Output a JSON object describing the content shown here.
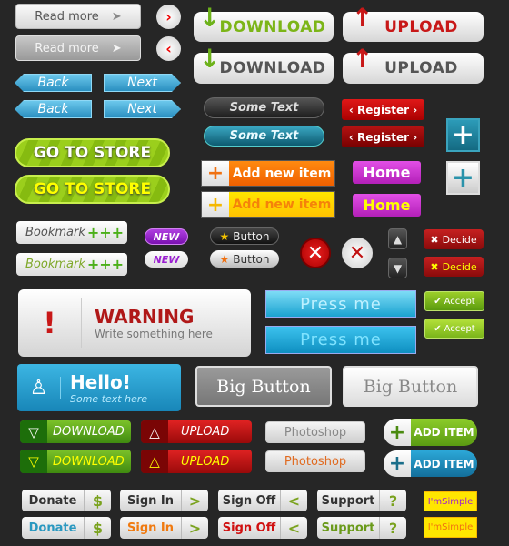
{
  "read_more": {
    "label": "Read more"
  },
  "download": {
    "label": "DOWNLOAD"
  },
  "upload": {
    "label": "UPLOAD"
  },
  "nav": {
    "back": "Back",
    "next": "Next"
  },
  "store": {
    "label": "GO TO STORE"
  },
  "some_text": {
    "label": "Some Text"
  },
  "register": {
    "label": "Register"
  },
  "add_new": {
    "label": "Add new item"
  },
  "home": {
    "label": "Home"
  },
  "bookmark": {
    "label": "Bookmark"
  },
  "new_badge": {
    "label": "NEW"
  },
  "button": {
    "label": "Button"
  },
  "decide": {
    "label": "Decide"
  },
  "warning": {
    "title": "WARNING",
    "subtitle": "Write something here"
  },
  "press": {
    "label": "Press me"
  },
  "accept": {
    "label": "Accept"
  },
  "hello": {
    "title": "Hello!",
    "subtitle": "Some text here"
  },
  "big": {
    "label": "Big Button"
  },
  "dl2": {
    "label": "DOWNLOAD"
  },
  "ul2": {
    "label": "UPLOAD"
  },
  "photoshop": {
    "label": "Photoshop"
  },
  "add_item": {
    "label": "ADD ITEM"
  },
  "donate": {
    "label": "Donate"
  },
  "signin": {
    "label": "Sign In"
  },
  "signoff": {
    "label": "Sign Off"
  },
  "support": {
    "label": "Support"
  },
  "simple": {
    "label": "I'mSimple"
  },
  "colors": {
    "background": "#262626",
    "green": "#8cc31a",
    "red": "#c81818",
    "blue": "#2a9ac8",
    "magenta": "#c62fcb",
    "orange": "#ff7a00",
    "yellow": "#ffe600"
  }
}
